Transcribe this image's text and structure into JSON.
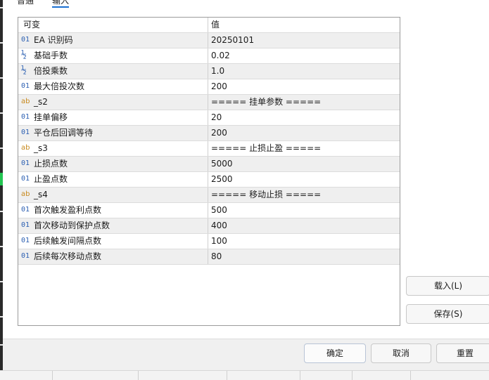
{
  "tabs": [
    {
      "label": "普通"
    },
    {
      "label": "输入"
    }
  ],
  "table": {
    "header": {
      "col1": "可变",
      "col2": "值"
    },
    "rows": [
      {
        "icon": "01",
        "icon_name": "integer-type-icon",
        "name": "EA 识别码",
        "value": "20250101"
      },
      {
        "icon": "½",
        "icon_name": "double-type-icon",
        "name": "基础手数",
        "value": "0.02"
      },
      {
        "icon": "½",
        "icon_name": "double-type-icon",
        "name": "倍投乘数",
        "value": "1.0"
      },
      {
        "icon": "01",
        "icon_name": "integer-type-icon",
        "name": "最大倍投次数",
        "value": "200"
      },
      {
        "icon": "ab",
        "icon_name": "string-type-icon",
        "name": "_s2",
        "value": "===== 挂单参数 ====="
      },
      {
        "icon": "01",
        "icon_name": "integer-type-icon",
        "name": "挂单偏移",
        "value": "20"
      },
      {
        "icon": "01",
        "icon_name": "integer-type-icon",
        "name": "平仓后回调等待",
        "value": "200"
      },
      {
        "icon": "ab",
        "icon_name": "string-type-icon",
        "name": "_s3",
        "value": "===== 止损止盈 ====="
      },
      {
        "icon": "01",
        "icon_name": "integer-type-icon",
        "name": "止损点数",
        "value": "5000"
      },
      {
        "icon": "01",
        "icon_name": "integer-type-icon",
        "name": "止盈点数",
        "value": "2500"
      },
      {
        "icon": "ab",
        "icon_name": "string-type-icon",
        "name": "_s4",
        "value": "===== 移动止损 ====="
      },
      {
        "icon": "01",
        "icon_name": "integer-type-icon",
        "name": "首次触发盈利点数",
        "value": "500"
      },
      {
        "icon": "01",
        "icon_name": "integer-type-icon",
        "name": "首次移动到保护点数",
        "value": "400"
      },
      {
        "icon": "01",
        "icon_name": "integer-type-icon",
        "name": "后续触发间隔点数",
        "value": "100"
      },
      {
        "icon": "01",
        "icon_name": "integer-type-icon",
        "name": "后续每次移动点数",
        "value": "80"
      }
    ]
  },
  "side_buttons": {
    "load": "载入(L)",
    "save": "保存(S)"
  },
  "footer_buttons": {
    "ok": "确定",
    "cancel": "取消",
    "reset": "重置"
  }
}
